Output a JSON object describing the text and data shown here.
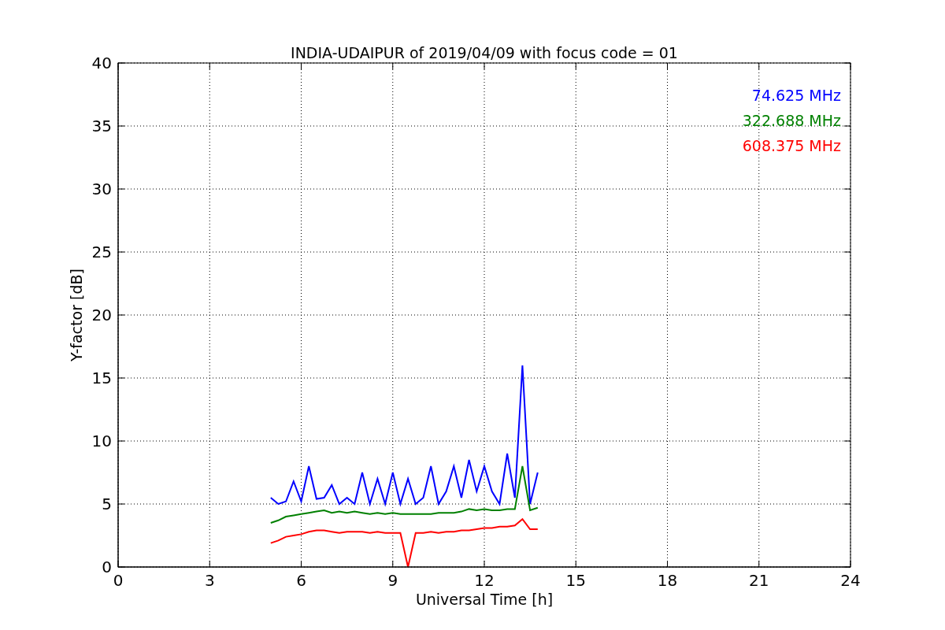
{
  "figure": {
    "chart_data": {
      "type": "line",
      "title": "INDIA-UDAIPUR of 2019/04/09 with focus code = 01",
      "xlabel": "Universal Time [h]",
      "ylabel": "Y-factor [dB]",
      "x": [
        5.0,
        5.25,
        5.5,
        5.75,
        6.0,
        6.25,
        6.5,
        6.75,
        7.0,
        7.25,
        7.5,
        7.75,
        8.0,
        8.25,
        8.5,
        8.75,
        9.0,
        9.25,
        9.5,
        9.75,
        10.0,
        10.25,
        10.5,
        10.75,
        11.0,
        11.25,
        11.5,
        11.75,
        12.0,
        12.25,
        12.5,
        12.75,
        13.0,
        13.25,
        13.5,
        13.75
      ],
      "series": [
        {
          "name": "74.625 MHz",
          "color": "#0000ff",
          "values": [
            5.5,
            5.0,
            5.2,
            6.8,
            5.2,
            8.0,
            5.4,
            5.5,
            6.5,
            5.0,
            5.5,
            5.0,
            7.5,
            5.0,
            7.0,
            5.0,
            7.5,
            5.0,
            7.0,
            5.0,
            5.5,
            8.0,
            5.0,
            6.0,
            8.0,
            5.5,
            8.5,
            6.0,
            8.0,
            6.0,
            5.0,
            9.0,
            5.5,
            16.0,
            5.0,
            7.5
          ]
        },
        {
          "name": "322.688 MHz",
          "color": "#008000",
          "values": [
            3.5,
            3.7,
            4.0,
            4.1,
            4.2,
            4.3,
            4.4,
            4.5,
            4.3,
            4.4,
            4.3,
            4.4,
            4.3,
            4.2,
            4.3,
            4.2,
            4.3,
            4.2,
            4.2,
            4.2,
            4.2,
            4.2,
            4.3,
            4.3,
            4.3,
            4.4,
            4.6,
            4.5,
            4.6,
            4.5,
            4.5,
            4.6,
            4.6,
            8.0,
            4.5,
            4.7
          ]
        },
        {
          "name": "608.375 MHz",
          "color": "#ff0000",
          "values": [
            1.9,
            2.1,
            2.4,
            2.5,
            2.6,
            2.8,
            2.9,
            2.9,
            2.8,
            2.7,
            2.8,
            2.8,
            2.8,
            2.7,
            2.8,
            2.7,
            2.7,
            2.7,
            0.0,
            2.7,
            2.7,
            2.8,
            2.7,
            2.8,
            2.8,
            2.9,
            2.9,
            3.0,
            3.1,
            3.1,
            3.2,
            3.2,
            3.3,
            3.8,
            3.0,
            3.0
          ]
        }
      ],
      "grid": true,
      "xlim": [
        0,
        24
      ],
      "ylim": [
        0,
        40
      ],
      "xticks": [
        0,
        3,
        6,
        9,
        12,
        15,
        18,
        21,
        24
      ],
      "yticks": [
        0,
        5,
        10,
        15,
        20,
        25,
        30,
        35,
        40
      ]
    }
  }
}
